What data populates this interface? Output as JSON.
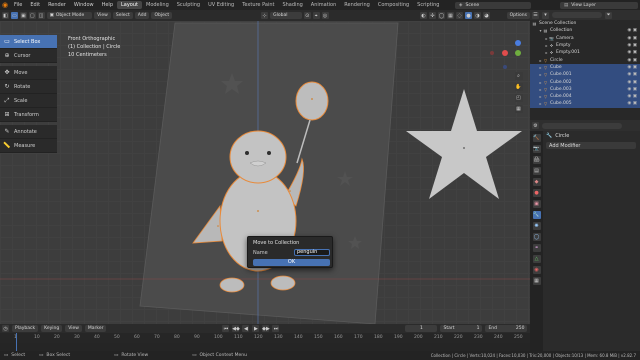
{
  "topbar": {
    "menus": [
      "File",
      "Edit",
      "Render",
      "Window",
      "Help"
    ],
    "tabs": [
      "Layout",
      "Modeling",
      "Sculpting",
      "UV Editing",
      "Texture Paint",
      "Shading",
      "Animation",
      "Rendering",
      "Compositing",
      "Scripting"
    ],
    "active_tab": "Layout",
    "scene": "Scene",
    "view_layer": "View Layer"
  },
  "header": {
    "mode": "Object Mode",
    "menus": [
      "View",
      "Select",
      "Add",
      "Object"
    ],
    "orientation": "Global",
    "options": "Options"
  },
  "toolbar": {
    "tools": [
      "Select Box",
      "Cursor",
      "Move",
      "Rotate",
      "Scale",
      "Transform",
      "Annotate",
      "Measure"
    ],
    "active": "Select Box"
  },
  "viewport": {
    "view_name": "Front Orthographic",
    "collection_info": "(1) Collection | Circle",
    "scale_info": "10 Centimeters"
  },
  "dialog": {
    "title": "Move to Collection",
    "name_label": "Name",
    "name_value": "penguin",
    "ok_label": "OK"
  },
  "outliner": {
    "root": "Scene Collection",
    "rows": [
      {
        "label": "Collection",
        "indent": 1,
        "type": "collection",
        "selected": false
      },
      {
        "label": "Camera",
        "indent": 2,
        "type": "camera",
        "selected": false
      },
      {
        "label": "Empty",
        "indent": 2,
        "type": "empty",
        "selected": false
      },
      {
        "label": "Empty.001",
        "indent": 2,
        "type": "empty",
        "selected": false
      },
      {
        "label": "Circle",
        "indent": 1,
        "type": "mesh",
        "selected": false
      },
      {
        "label": "Cube",
        "indent": 1,
        "type": "mesh",
        "selected": true
      },
      {
        "label": "Cube.001",
        "indent": 1,
        "type": "mesh",
        "selected": true
      },
      {
        "label": "Cube.002",
        "indent": 1,
        "type": "mesh",
        "selected": true
      },
      {
        "label": "Cube.003",
        "indent": 1,
        "type": "mesh",
        "selected": true
      },
      {
        "label": "Cube.004",
        "indent": 1,
        "type": "mesh",
        "selected": true
      },
      {
        "label": "Cube.005",
        "indent": 1,
        "type": "mesh",
        "selected": true
      }
    ]
  },
  "properties": {
    "object_name": "Circle",
    "add_modifier": "Add Modifier"
  },
  "timeline": {
    "menus": [
      "Playback",
      "Keying",
      "View",
      "Marker"
    ],
    "current_frame": "1",
    "start_label": "Start",
    "start": "1",
    "end_label": "End",
    "end": "250",
    "ticks": [
      "1",
      "10",
      "20",
      "30",
      "40",
      "50",
      "60",
      "70",
      "80",
      "90",
      "100",
      "110",
      "120",
      "130",
      "140",
      "150",
      "160",
      "170",
      "180",
      "190",
      "200",
      "210",
      "220",
      "230",
      "240",
      "250"
    ]
  },
  "statusbar": {
    "select": "Select",
    "box_select": "Box Select",
    "rotate_view": "Rotate View",
    "context_menu": "Object Context Menu",
    "stats": "Collection | Circle | Verts:10,024 | Faces:10,030 | Tris:20,000 | Objects:10/13 | Mem: 60.8 MiB | v2.82.7"
  },
  "colors": {
    "accent": "#4772b3",
    "selection_outline": "#e88a3a",
    "active_tab": "#474747"
  }
}
